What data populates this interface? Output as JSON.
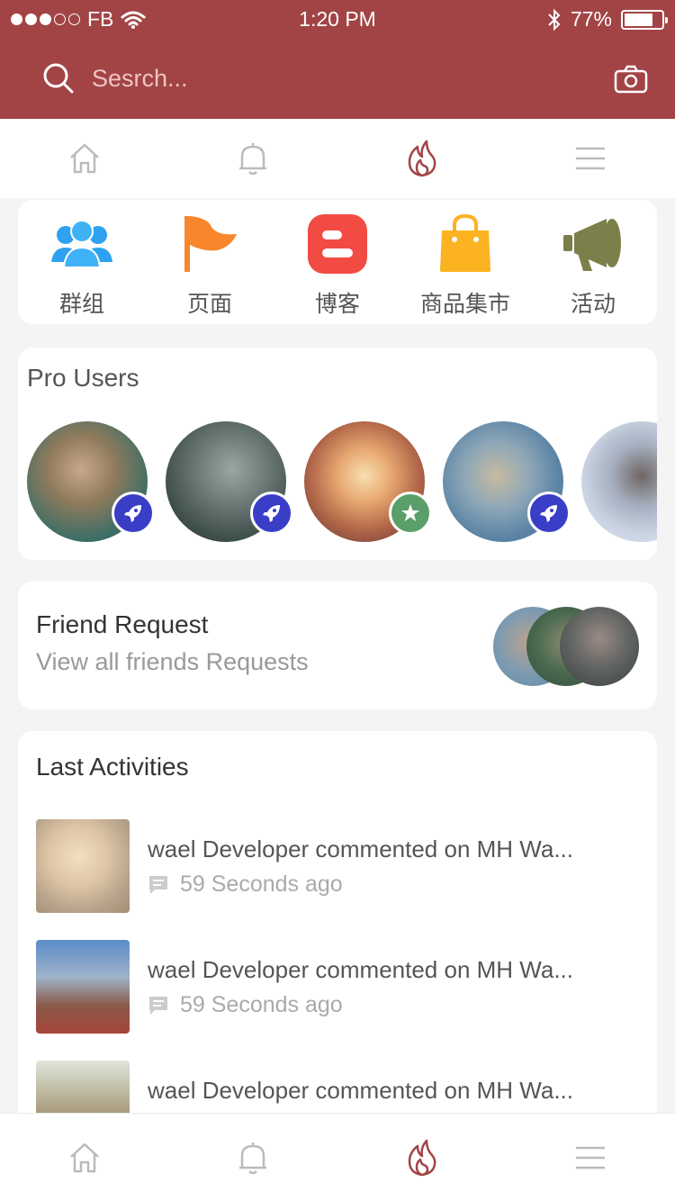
{
  "status": {
    "carrier": "FB",
    "time": "1:20 PM",
    "battery_text": "77%",
    "battery_level": 0.77
  },
  "search": {
    "placeholder": "Sesrch..."
  },
  "categories": [
    {
      "label": "群组",
      "icon": "group-icon",
      "color": "#2ea1f0"
    },
    {
      "label": "页面",
      "icon": "flag-icon",
      "color": "#f7862c"
    },
    {
      "label": "博客",
      "icon": "blog-icon",
      "color": "#f24b44"
    },
    {
      "label": "商品集市",
      "icon": "shopping-bag-icon",
      "color": "#fbb321"
    },
    {
      "label": "活动",
      "icon": "megaphone-icon",
      "color": "#7c7f49"
    }
  ],
  "pro_users": {
    "title": "Pro Users"
  },
  "friend_request": {
    "title": "Friend Request",
    "subtitle": "View all friends Requests"
  },
  "activities": {
    "title": "Last Activities",
    "items": [
      {
        "text": "wael Developer commented on MH Wa...",
        "time": "59 Seconds ago"
      },
      {
        "text": "wael Developer commented on MH Wa...",
        "time": "59 Seconds ago"
      },
      {
        "text": "wael Developer commented on MH Wa...",
        "time": ""
      }
    ]
  },
  "colors": {
    "header": "#a24446",
    "active_tab": "#a24446",
    "badge_rocket": "#3a3ec7",
    "badge_star": "#5a9f6a"
  }
}
